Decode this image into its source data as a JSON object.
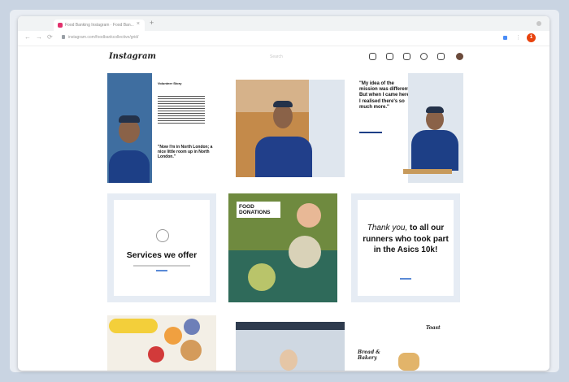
{
  "browser": {
    "tab_title": "Food Banking Instagram · Food Ban...",
    "new_tab": "+",
    "tab_close": "×",
    "url": "instagram.com/foodbankcollective/grid/",
    "back": "←",
    "forward": "→",
    "reload": "⟳",
    "profile_badge": "1"
  },
  "instagram": {
    "logo": "Instagram",
    "search_placeholder": "Search"
  },
  "posts": {
    "p1": {
      "heading": "Volunteer Story",
      "quote": "\"Now I'm in North London; a nice little room up in North London.\""
    },
    "p3": {
      "quote": "\"My idea of the mission was different. But when I came here, I realised there's so much more.\""
    },
    "p4": {
      "title": "Services we offer"
    },
    "p5": {
      "label": "FOOD DONATIONS"
    },
    "p6": {
      "thanks_italic": "Thank you,",
      "thanks_rest": " to all our runners who took part in the Asics 10k!"
    },
    "p9": {
      "handwriting_1": "Toast",
      "handwriting_2": "Bread & Bakery"
    }
  },
  "colors": {
    "accent": "#e1306c",
    "brand_blue": "#1d3f86",
    "profile_badge": "#e8430e"
  }
}
